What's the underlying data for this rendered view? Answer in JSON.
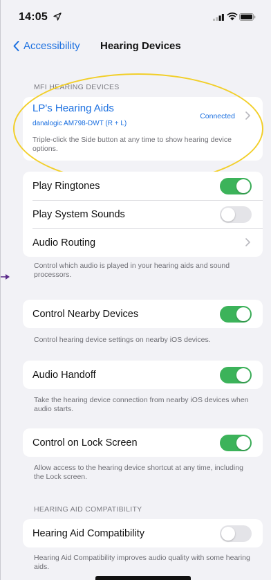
{
  "status_bar": {
    "time": "14:05"
  },
  "nav": {
    "back_label": "Accessibility",
    "title": "Hearing Devices"
  },
  "mfi": {
    "header": "MFI HEARING DEVICES",
    "device_name": "LP's Hearing Aids",
    "device_model": "danalogic AM798-DWT (R + L)",
    "device_status": "Connected",
    "hint": "Triple-click the Side button at any time to show hearing device options."
  },
  "group1": {
    "rows": [
      {
        "label": "Play Ringtones",
        "on": true
      },
      {
        "label": "Play System Sounds",
        "on": false
      },
      {
        "label": "Audio Routing"
      }
    ],
    "footer": "Control which audio is played in your hearing aids and sound processors."
  },
  "nearby": {
    "label": "Control Nearby Devices",
    "on": true,
    "footer": "Control hearing device settings on nearby iOS devices."
  },
  "handoff": {
    "label": "Audio Handoff",
    "on": true,
    "footer": "Take the hearing device connection from nearby iOS devices when audio starts."
  },
  "lock": {
    "label": "Control on Lock Screen",
    "on": true,
    "footer": "Allow access to the hearing device shortcut at any time, including the Lock screen."
  },
  "hac": {
    "header": "HEARING AID COMPATIBILITY",
    "label": "Hearing Aid Compatibility",
    "on": false,
    "footer": "Hearing Aid Compatibility improves audio quality with some hearing aids."
  },
  "colors": {
    "accent": "#1a6fe0",
    "toggle_on": "#3cb35a",
    "highlight": "#f2cf2a",
    "arrow": "#5b2b8a"
  },
  "icons": [
    "location-arrow-icon",
    "cellular-signal-icon",
    "wifi-icon",
    "battery-icon",
    "chevron-left-icon",
    "chevron-right-icon"
  ]
}
